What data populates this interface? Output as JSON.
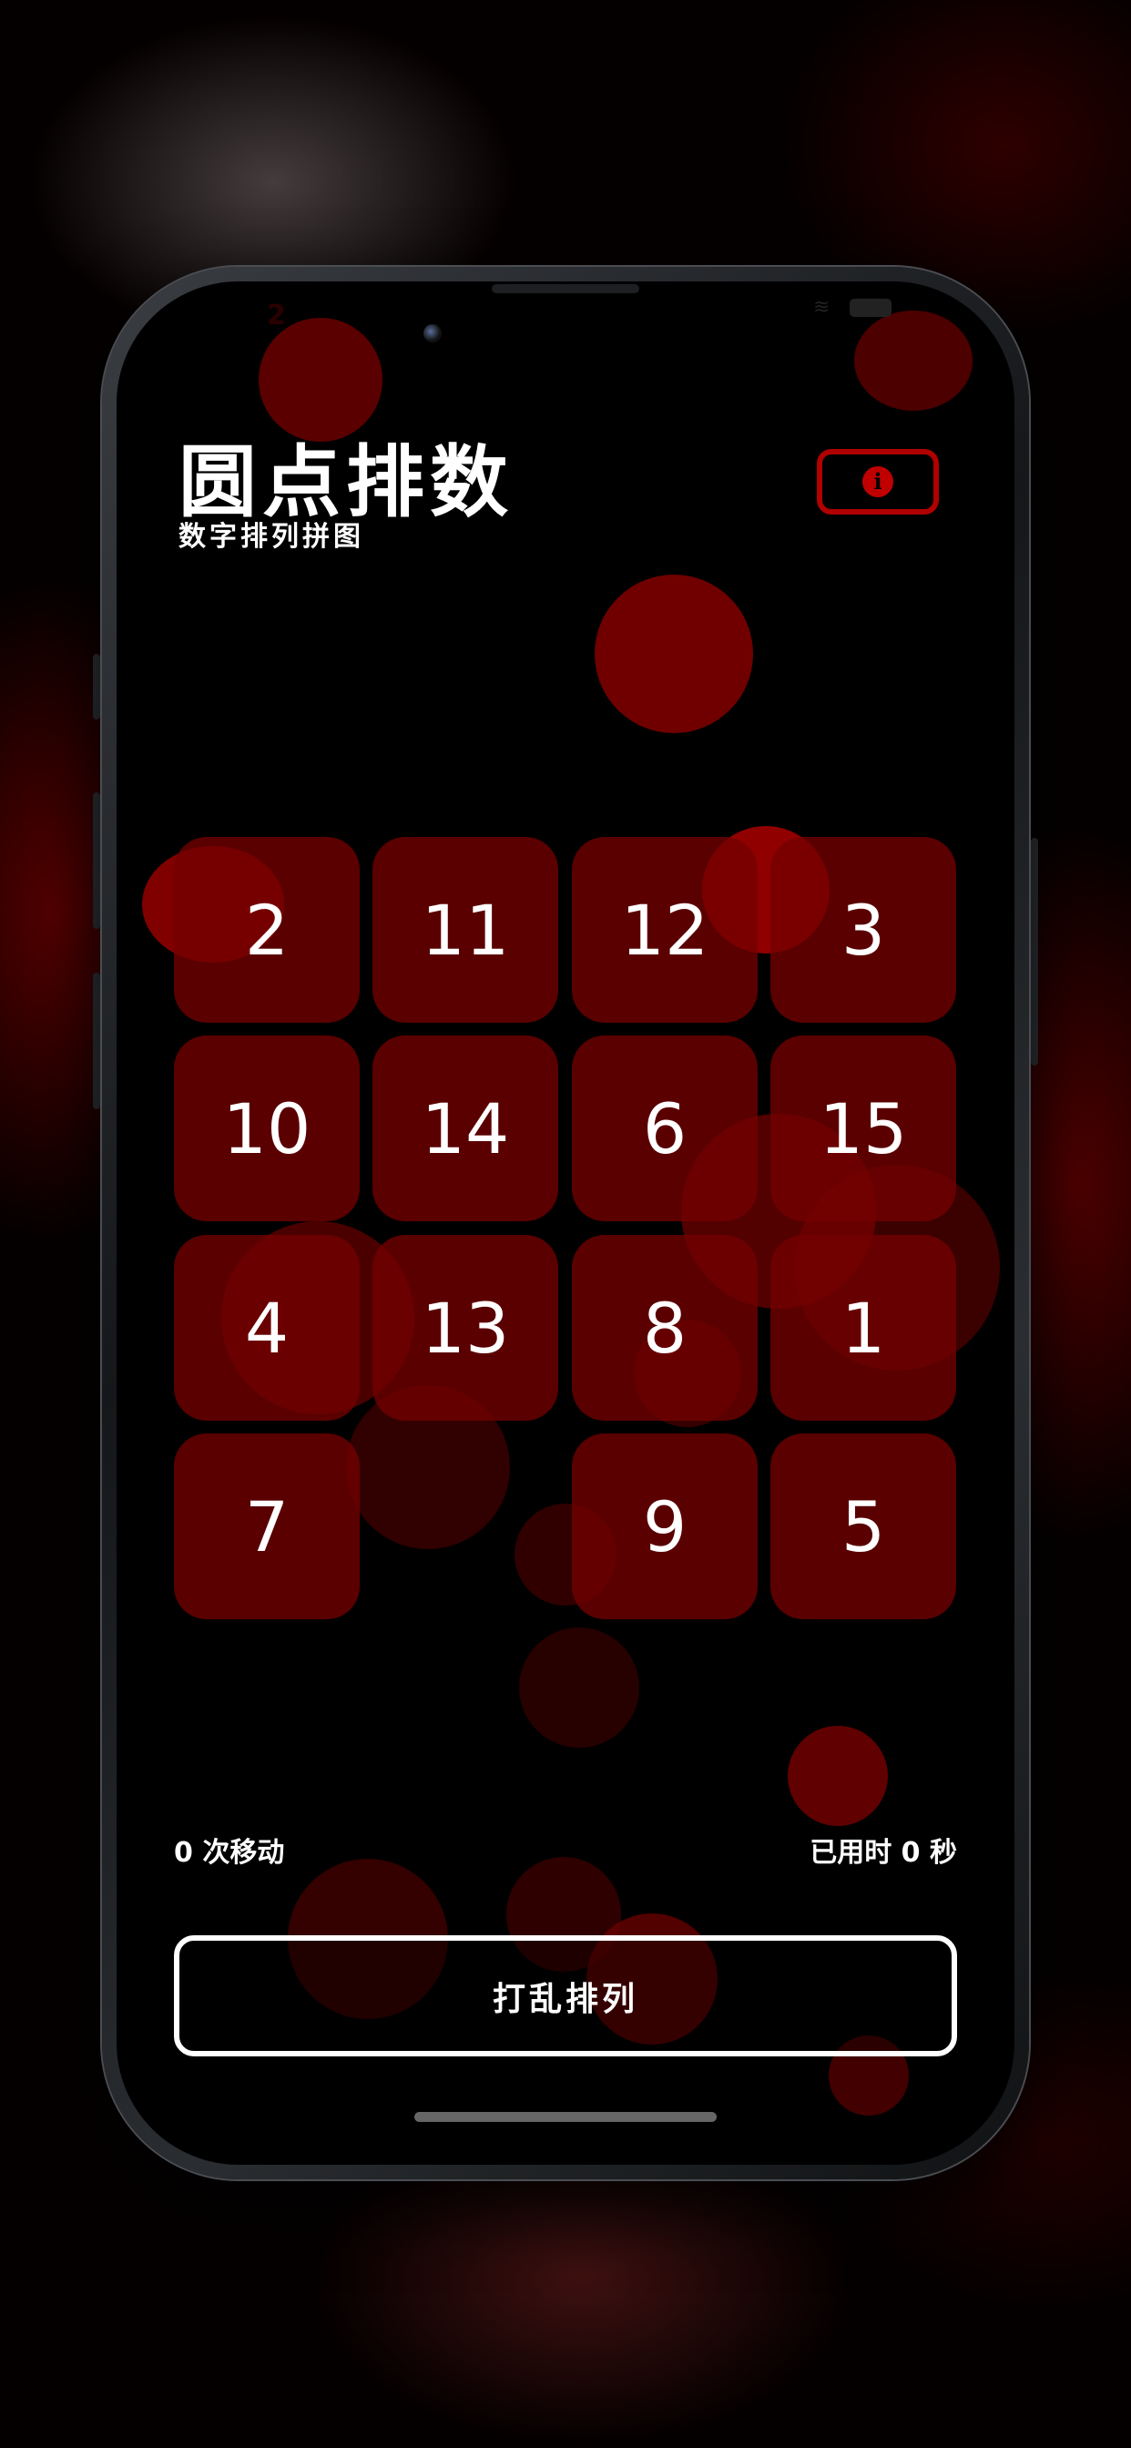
{
  "status_bar": {
    "time": "2"
  },
  "header": {
    "title": "圆点排数",
    "subtitle": "数字排列拼图",
    "info_icon": "info-circle-icon"
  },
  "board": {
    "rows": [
      [
        "2",
        "11",
        "12",
        "3"
      ],
      [
        "10",
        "14",
        "6",
        "15"
      ],
      [
        "4",
        "13",
        "8",
        "1"
      ],
      [
        "7",
        "",
        "9",
        "5"
      ]
    ]
  },
  "stats": {
    "moves": "0 次移动",
    "time": "已用时 0 秒"
  },
  "shuffle_button": {
    "label": "打乱排列"
  },
  "colors": {
    "tile": "#730000",
    "accent_red": "#b00000",
    "background": "#000000",
    "text": "#ffffff"
  }
}
